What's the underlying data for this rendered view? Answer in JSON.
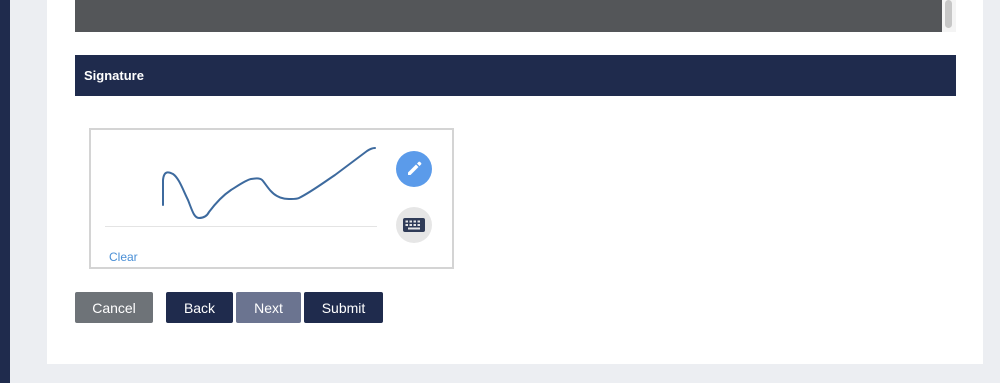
{
  "section": {
    "title": "Signature"
  },
  "signature_pad": {
    "clear_label": "Clear",
    "active_mode": "draw",
    "draw_mode_icon": "pencil-icon",
    "type_mode_icon": "keyboard-icon",
    "stroke_color": "#3d6a9e"
  },
  "buttons": {
    "cancel": "Cancel",
    "back": "Back",
    "next": "Next",
    "submit": "Submit"
  },
  "colors": {
    "navy": "#1f2b4d",
    "accent_blue": "#5b9bea",
    "link_blue": "#4a8fd6",
    "cancel_gray": "#6e7378",
    "next_disabled": "#6b7490"
  }
}
